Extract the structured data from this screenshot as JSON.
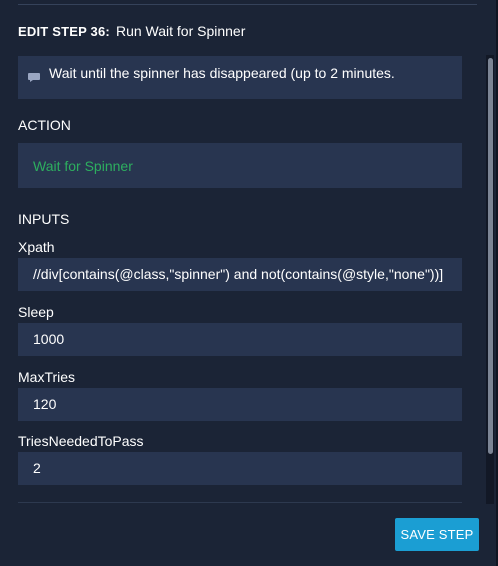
{
  "header": {
    "step_label": "EDIT STEP 36:",
    "title": "Run Wait for Spinner"
  },
  "description": {
    "icon": "comment-icon",
    "text": "Wait until the spinner has disappeared (up to 2 minutes."
  },
  "action": {
    "section_label": "ACTION",
    "value": "Wait for Spinner",
    "color": "#2dae5f"
  },
  "inputs": {
    "section_label": "INPUTS",
    "fields": [
      {
        "label": "Xpath",
        "value": "//div[contains(@class,\"spinner\") and not(contains(@style,\"none\"))]"
      },
      {
        "label": "Sleep",
        "value": "1000"
      },
      {
        "label": "MaxTries",
        "value": "120"
      },
      {
        "label": "TriesNeededToPass",
        "value": "2"
      }
    ]
  },
  "footer": {
    "save_label": "SAVE STEP",
    "save_color": "#1b9ed3"
  }
}
